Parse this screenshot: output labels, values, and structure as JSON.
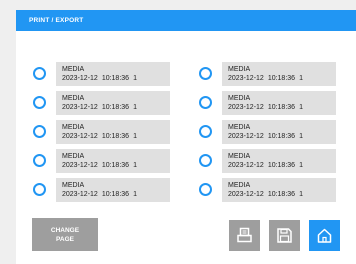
{
  "header": {
    "title": "PRINT / EXPORT"
  },
  "items": [
    {
      "label": "MEDIA",
      "date": "2023-12-12",
      "time": "10:18:36",
      "count": "1"
    },
    {
      "label": "MEDIA",
      "date": "2023-12-12",
      "time": "10:18:36",
      "count": "1"
    },
    {
      "label": "MEDIA",
      "date": "2023-12-12",
      "time": "10:18:36",
      "count": "1"
    },
    {
      "label": "MEDIA",
      "date": "2023-12-12",
      "time": "10:18:36",
      "count": "1"
    },
    {
      "label": "MEDIA",
      "date": "2023-12-12",
      "time": "10:18:36",
      "count": "1"
    },
    {
      "label": "MEDIA",
      "date": "2023-12-12",
      "time": "10:18:36",
      "count": "1"
    },
    {
      "label": "MEDIA",
      "date": "2023-12-12",
      "time": "10:18:36",
      "count": "1"
    },
    {
      "label": "MEDIA",
      "date": "2023-12-12",
      "time": "10:18:36",
      "count": "1"
    },
    {
      "label": "MEDIA",
      "date": "2023-12-12",
      "time": "10:18:36",
      "count": "1"
    },
    {
      "label": "MEDIA",
      "date": "2023-12-12",
      "time": "10:18:36",
      "count": "1"
    }
  ],
  "footer": {
    "change_page_line1": "CHANGE",
    "change_page_line2": "PAGE",
    "icons": [
      "print-icon",
      "save-icon",
      "home-icon"
    ]
  },
  "colors": {
    "accent": "#2196f3",
    "button_gray": "#9e9e9e",
    "card_bg": "#e0e0e0"
  }
}
